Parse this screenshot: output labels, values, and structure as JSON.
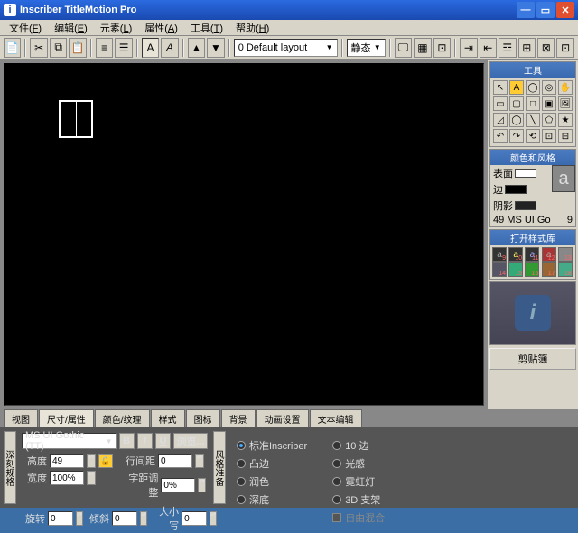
{
  "window": {
    "icon": "i",
    "title": "Inscriber TitleMotion Pro"
  },
  "menu": [
    "文件",
    "编辑",
    "元素",
    "属性",
    "工具",
    "帮助"
  ],
  "menuAccel": [
    "F",
    "E",
    "L",
    "A",
    "T",
    "H"
  ],
  "layoutCombo": "0 Default layout",
  "animCombo": "静态",
  "side": {
    "toolsTitle": "工具",
    "colorTitle": "颜色和风格",
    "surface": "表面",
    "edge": "边",
    "shadow": "阴影",
    "fontLine": "49 MS UI Go",
    "fontNum": "9",
    "glyph": "a",
    "styleTitle": "打开样式库",
    "clipboard": "剪贴簿"
  },
  "tabs": [
    "视图",
    "尺寸/属性",
    "颜色/纹理",
    "样式",
    "图标",
    "背景",
    "动画设置",
    "文本编辑"
  ],
  "activeTab": 1,
  "bottom": {
    "vtab1": "深刻规格",
    "vtab2": "风格准备",
    "font": "MS UI Gothic (TT)",
    "browse": "浏览...",
    "height": "高度",
    "heightVal": "49",
    "width": "宽度",
    "widthVal": "100%",
    "leading": "行间距",
    "leadingVal": "0",
    "kerning": "字距调整",
    "kerningVal": "0%",
    "rotate": "旋转",
    "rotateVal": "0",
    "skew": "倾斜",
    "skewVal": "0",
    "smallcaps": "大小写",
    "smallcapsVal": "0",
    "radios1": [
      "标准Inscriber",
      "凸边",
      "润色",
      "深底"
    ],
    "radios2": [
      "10 边",
      "光感",
      "霓虹灯",
      "3D 支架"
    ],
    "freeform": "自由混合"
  }
}
